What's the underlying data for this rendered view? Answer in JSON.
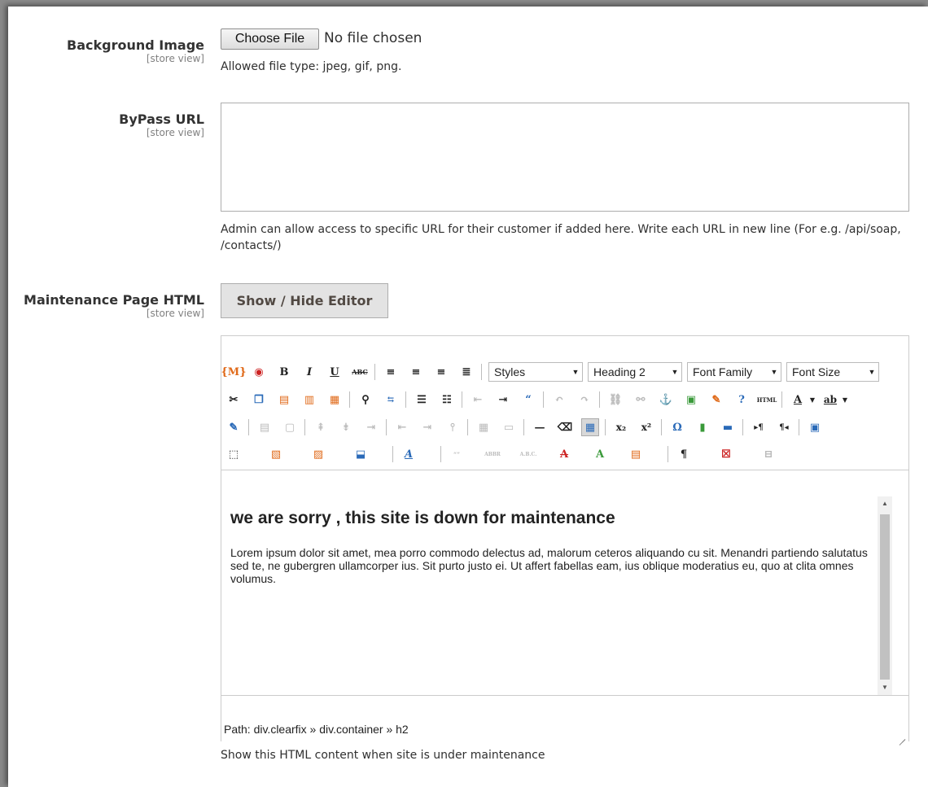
{
  "fields": {
    "background_image": {
      "label": "Background Image",
      "scope": "[store view]",
      "button": "Choose File",
      "file_status": "No file chosen",
      "note": "Allowed file type: jpeg, gif, png."
    },
    "bypass_url": {
      "label": "ByPass URL",
      "scope": "[store view]",
      "value": "",
      "note": "Admin can allow access to specific URL for their customer if added here. Write each URL in new line (For e.g. /api/soap, /contacts/)"
    },
    "maintenance_html": {
      "label": "Maintenance Page HTML",
      "scope": "[store view]",
      "toggle_button": "Show / Hide Editor",
      "note": "Show this HTML content when site is under maintenance"
    }
  },
  "editor": {
    "dropdowns": {
      "styles": "Styles",
      "format": "Heading 2",
      "font_family": "Font Family",
      "font_size": "Font Size"
    },
    "glyphs": {
      "bold": "B",
      "italic": "I",
      "underline": "U",
      "strike": "ABC",
      "html": "HTML",
      "font_color": "A",
      "bg_color": "ab",
      "omega": "Ω",
      "pilcrow": "¶",
      "dash": "—",
      "subscript": "x₂",
      "superscript": "x²",
      "cite": "“”",
      "abbr": "ABBR",
      "acronym": "A.B.C.",
      "quote": "“"
    },
    "content": {
      "heading": "we are sorry , this site is down for maintenance",
      "paragraph": "Lorem ipsum dolor sit amet, mea porro commodo delectus ad, malorum ceteros aliquando cu sit. Menandri partiendo salutatus sed te, ne gubergren ullamcorper ius. Sit purto justo ei. Ut affert fabellas eam, ius oblique moderatius eu, quo at clita omnes volumus."
    },
    "path": "Path: div.clearfix » div.container » h2"
  },
  "colors": {
    "frame_bg": "#ffffff",
    "outer_bg": "#8a8a8a",
    "button_bg": "#e3e3e3",
    "button_text": "#514943",
    "label_text": "#333333",
    "scope_text": "#808080"
  }
}
